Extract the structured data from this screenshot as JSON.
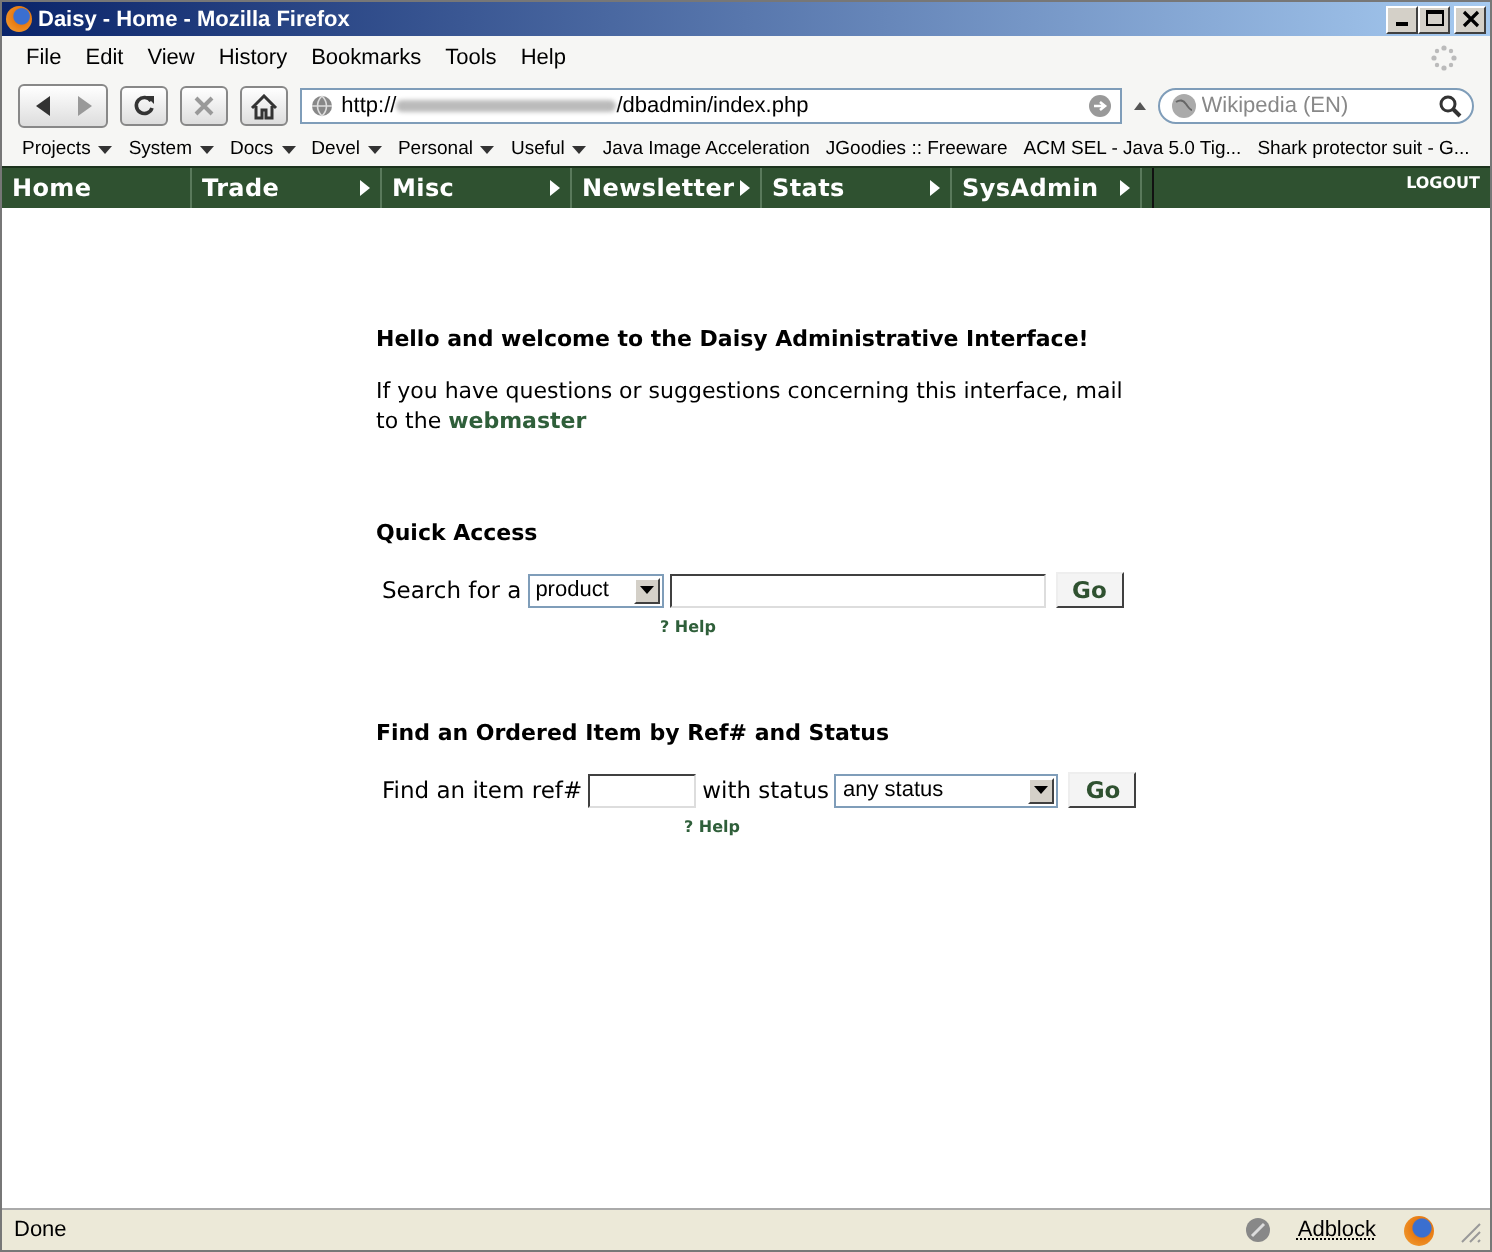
{
  "window": {
    "title": "Daisy - Home - Mozilla Firefox"
  },
  "menu": [
    "File",
    "Edit",
    "View",
    "History",
    "Bookmarks",
    "Tools",
    "Help"
  ],
  "address": {
    "prefix": "http://",
    "suffix": "/dbadmin/index.php"
  },
  "search": {
    "placeholder": "Wikipedia (EN)"
  },
  "bookmarks": [
    {
      "label": "Projects",
      "folder": true
    },
    {
      "label": "System",
      "folder": true
    },
    {
      "label": "Docs",
      "folder": true
    },
    {
      "label": "Devel",
      "folder": true
    },
    {
      "label": "Personal",
      "folder": true
    },
    {
      "label": "Useful",
      "folder": true
    },
    {
      "label": "Java Image Acceleration",
      "folder": false
    },
    {
      "label": "JGoodies :: Freeware",
      "folder": false
    },
    {
      "label": "ACM SEL - Java 5.0 Tig...",
      "folder": false
    },
    {
      "label": "Shark protector suit - G...",
      "folder": false
    }
  ],
  "nav": {
    "items": [
      {
        "label": "Home",
        "submenu": false
      },
      {
        "label": "Trade",
        "submenu": true
      },
      {
        "label": "Misc",
        "submenu": true
      },
      {
        "label": "Newsletter",
        "submenu": true
      },
      {
        "label": "Stats",
        "submenu": true
      },
      {
        "label": "SysAdmin",
        "submenu": true
      }
    ],
    "logout": "LOGOUT"
  },
  "welcome": {
    "heading": "Hello and welcome to the Daisy Administrative Interface!",
    "text": "If you have questions or suggestions concerning this interface, mail to the",
    "link": "webmaster"
  },
  "quick_access": {
    "heading": "Quick Access",
    "label": "Search for a",
    "select": "product",
    "button": "Go",
    "help": "? Help"
  },
  "find_item": {
    "heading": "Find an Ordered Item by Ref# and Status",
    "label": "Find an item ref#",
    "status_label": "with status",
    "select": "any status",
    "button": "Go",
    "help": "? Help"
  },
  "status_bar": {
    "text": "Done",
    "adblock": "Adblock"
  }
}
